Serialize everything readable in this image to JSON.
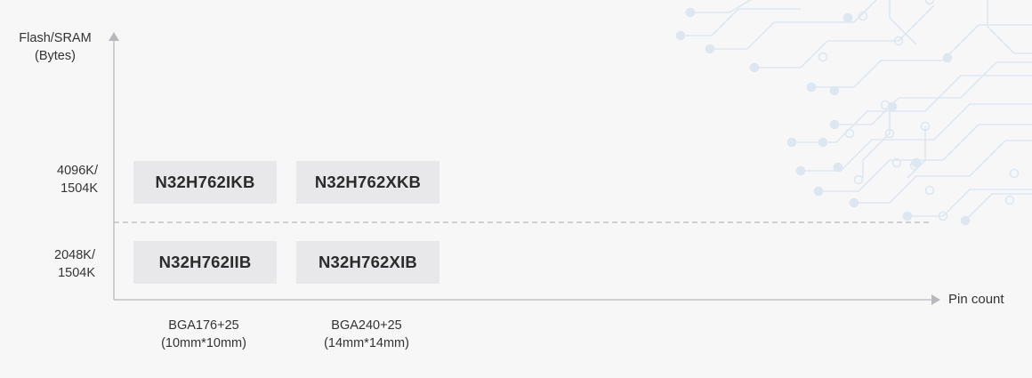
{
  "chart_data": {
    "type": "table",
    "ylabel": "Flash/SRAM\n(Bytes)",
    "xlabel": "Pin count",
    "y_categories": [
      "4096K/\n1504K",
      "2048K/\n1504K"
    ],
    "x_categories": [
      "BGA176+25\n(10mm*10mm)",
      "BGA240+25\n(14mm*14mm)"
    ],
    "cells": [
      {
        "row": 0,
        "col": 0,
        "label": "N32H762IKB"
      },
      {
        "row": 0,
        "col": 1,
        "label": "N32H762XKB"
      },
      {
        "row": 1,
        "col": 0,
        "label": "N32H762IIB"
      },
      {
        "row": 1,
        "col": 1,
        "label": "N32H762XIB"
      }
    ],
    "grid": "dashed separator between rows",
    "colors": {
      "background": "#f7f7f8",
      "axis": "#b8b8bd",
      "box_fill": "#e8e8ea",
      "text": "#333333",
      "circuit_decoration": "#dde7f2"
    }
  }
}
